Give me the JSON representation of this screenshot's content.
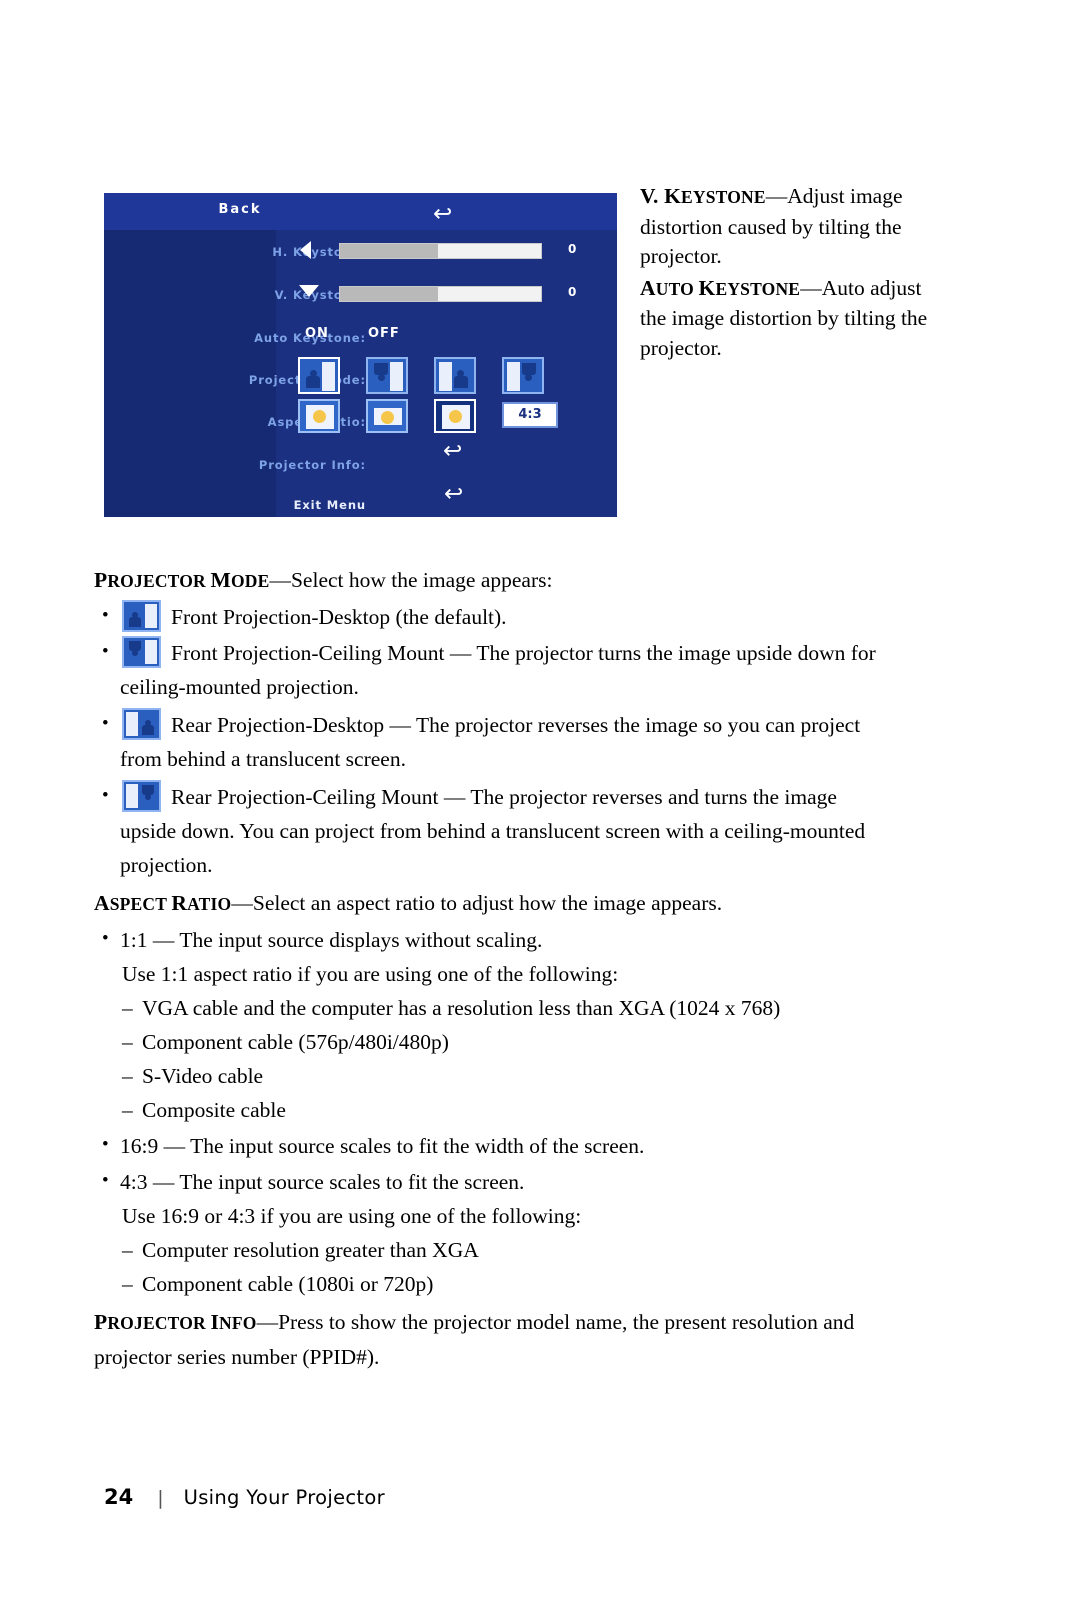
{
  "osd": {
    "title": "Back",
    "rows": [
      {
        "label": "H. Keystone:",
        "value": "0"
      },
      {
        "label": "V. Keystone:",
        "value": "0"
      },
      {
        "label": "Auto Keystone:"
      },
      {
        "label": "Projector Mode:"
      },
      {
        "label": "Aspect Ratio:"
      },
      {
        "label": "Projector Info:"
      },
      {
        "label": "Exit Menu"
      }
    ],
    "auto_keystone": {
      "on": "ON",
      "off": "OFF"
    },
    "aspect_value": "4:3",
    "return_arrow": "↩"
  },
  "right_column": {
    "p1_head_big": "V. K",
    "p1_head_small": "EYSTONE",
    "p1_dash": "—",
    "p1_body": "Adjust image distortion caused by tilting the projector.",
    "p2_head_big": "A",
    "p2_head_small1": "UTO ",
    "p2_head_big2": "K",
    "p2_head_small2": "EYSTONE",
    "p2_dash": "—",
    "p2_body": "Auto adjust the image distortion by tilting the projector."
  },
  "body": {
    "projector_mode_head_big": "P",
    "projector_mode_head_small": "ROJECTOR ",
    "projector_mode_head_big2": "M",
    "projector_mode_head_small2": "ODE",
    "projector_mode_dash": "—",
    "projector_mode_text": "Select how the image appears:",
    "mode_items": [
      "Front Projection-Desktop (the default).",
      "Front Projection-Ceiling Mount — The projector turns the image upside down for ceiling-mounted projection.",
      "Rear Projection-Desktop — The projector reverses the image so you can project from behind a translucent screen.",
      "Rear Projection-Ceiling Mount — The projector reverses and turns the image upside down. You can project from behind a translucent screen with a ceiling-mounted projection."
    ],
    "aspect_head_big": "A",
    "aspect_head_small": "SPECT ",
    "aspect_head_big2": "R",
    "aspect_head_small2": "ATIO",
    "aspect_dash": "—",
    "aspect_text": "Select an aspect ratio to adjust how the image appears.",
    "aspect_b1": "1:1 — The input source displays without scaling.",
    "aspect_b1_sub": "Use 1:1 aspect ratio if you are using one of the following:",
    "aspect_b1_dashes": [
      "VGA cable and the computer has a resolution less than XGA (1024 x 768)",
      "Component cable (576p/480i/480p)",
      "S-Video cable",
      "Composite cable"
    ],
    "aspect_b2": "16:9 — The input source scales to fit the width of the screen.",
    "aspect_b3": "4:3 — The input source scales to fit the screen.",
    "aspect_b3_sub": "Use 16:9 or 4:3 if you are using one of the following:",
    "aspect_b3_dashes": [
      "Computer resolution greater than XGA",
      "Component cable (1080i or 720p)"
    ],
    "info_head_big": "P",
    "info_head_small": "ROJECTOR ",
    "info_head_big2": "I",
    "info_head_small2": "NFO",
    "info_dash": "—",
    "info_text": "Press to show the projector model name, the present resolution and projector series number (PPID#)."
  },
  "footer": {
    "page_number": "24",
    "separator": "|",
    "title": "Using Your Projector"
  }
}
